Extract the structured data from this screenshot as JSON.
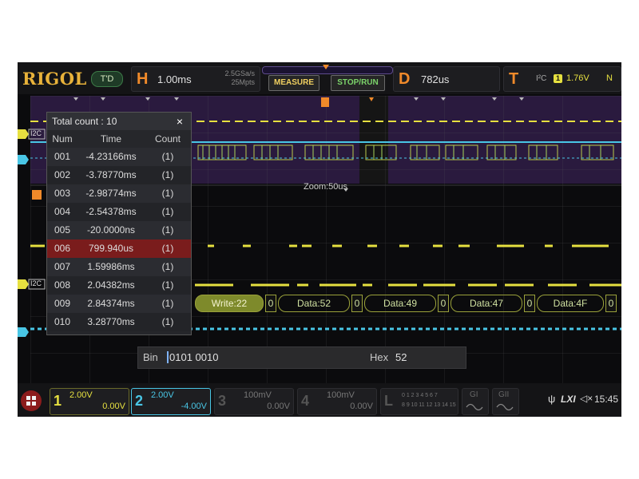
{
  "header": {
    "brand": "RIGOL",
    "mode_badge": "T'D",
    "horizontal": {
      "letter": "H",
      "timebase": "1.00ms",
      "sample_rate": "2.5GSa/s",
      "memory_depth": "25Mpts"
    },
    "measure_label": "MEASURE",
    "run_label": "STOP/RUN",
    "delay": {
      "letter": "D",
      "value": "782us"
    },
    "trigger": {
      "letter": "T",
      "type": "I²C",
      "channel": "1",
      "level": "1.76V",
      "mode": "N"
    }
  },
  "waveform": {
    "zoom_label": "Zoom:50us",
    "ch1_tag": "1",
    "ch2_tag": "2",
    "bus_tag_upper": "I2C",
    "bus_tag_lower": "I2C",
    "decode_frames": [
      {
        "type": "write",
        "text": "Write:22",
        "ack": "0"
      },
      {
        "type": "data",
        "text": "Data:52",
        "ack": "0"
      },
      {
        "type": "data",
        "text": "Data:49",
        "ack": "0"
      },
      {
        "type": "data",
        "text": "Data:47",
        "ack": "0"
      },
      {
        "type": "data",
        "text": "Data:4F",
        "ack": "0"
      }
    ]
  },
  "event_table": {
    "title": "Total count : 10",
    "close_icon": "×",
    "columns": [
      "Num",
      "Time",
      "Count"
    ],
    "rows": [
      {
        "num": "001",
        "time": "-4.23166ms",
        "count": "(1)"
      },
      {
        "num": "002",
        "time": "-3.78770ms",
        "count": "(1)"
      },
      {
        "num": "003",
        "time": "-2.98774ms",
        "count": "(1)"
      },
      {
        "num": "004",
        "time": "-2.54378ms",
        "count": "(1)"
      },
      {
        "num": "005",
        "time": "-20.0000ns",
        "count": "(1)"
      },
      {
        "num": "006",
        "time": "799.940us",
        "count": "(1)"
      },
      {
        "num": "007",
        "time": "1.59986ms",
        "count": "(1)"
      },
      {
        "num": "008",
        "time": "2.04382ms",
        "count": "(1)"
      },
      {
        "num": "009",
        "time": "2.84374ms",
        "count": "(1)"
      },
      {
        "num": "010",
        "time": "3.28770ms",
        "count": "(1)"
      }
    ],
    "selected_row": "006"
  },
  "value_bar": {
    "bin_label": "Bin",
    "bin_value": "0101 0010",
    "hex_label": "Hex",
    "hex_value": "52"
  },
  "footer": {
    "channels": [
      {
        "num": "1",
        "scale": "2.00V",
        "offset": "0.00V",
        "color": "#e6e040",
        "active": true
      },
      {
        "num": "2",
        "scale": "2.00V",
        "offset": "-4.00V",
        "color": "#49c6e5",
        "active": true
      },
      {
        "num": "3",
        "scale": "100mV",
        "offset": "0.00V",
        "color": "#666666",
        "active": false
      },
      {
        "num": "4",
        "scale": "100mV",
        "offset": "0.00V",
        "color": "#666666",
        "active": false
      }
    ],
    "logic": {
      "letter": "L",
      "row1": "0 1 2 3  4 5 6 7",
      "row2": "8 9 10 11 12 13 14 15"
    },
    "generator1": "GI",
    "generator2": "GII",
    "usb_icon": "usb-icon",
    "lxi_label": "LXI",
    "sound_icon": "speaker-icon",
    "clock": "15:45"
  },
  "colors": {
    "ch1": "#e6e040",
    "ch2": "#49c6e5",
    "accent": "#f08a2a",
    "zoom_band": "#2a1a3e",
    "selected_row": "#7a1c1c"
  }
}
